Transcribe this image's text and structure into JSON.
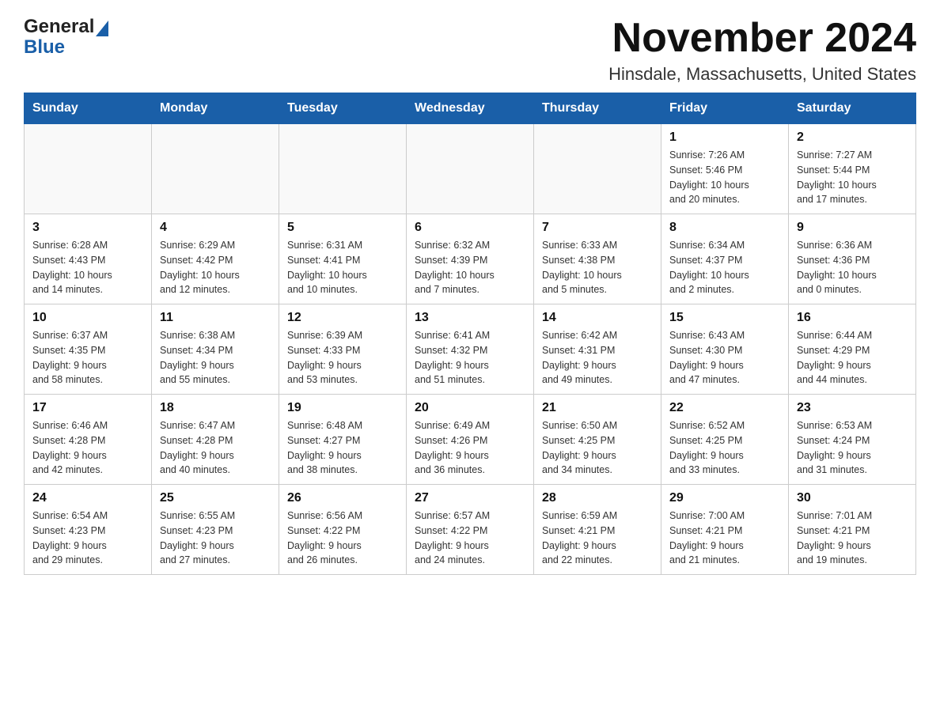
{
  "header": {
    "logo_general": "General",
    "logo_blue": "Blue",
    "title": "November 2024",
    "subtitle": "Hinsdale, Massachusetts, United States"
  },
  "days_of_week": [
    "Sunday",
    "Monday",
    "Tuesday",
    "Wednesday",
    "Thursday",
    "Friday",
    "Saturday"
  ],
  "weeks": [
    [
      {
        "day": "",
        "info": ""
      },
      {
        "day": "",
        "info": ""
      },
      {
        "day": "",
        "info": ""
      },
      {
        "day": "",
        "info": ""
      },
      {
        "day": "",
        "info": ""
      },
      {
        "day": "1",
        "info": "Sunrise: 7:26 AM\nSunset: 5:46 PM\nDaylight: 10 hours\nand 20 minutes."
      },
      {
        "day": "2",
        "info": "Sunrise: 7:27 AM\nSunset: 5:44 PM\nDaylight: 10 hours\nand 17 minutes."
      }
    ],
    [
      {
        "day": "3",
        "info": "Sunrise: 6:28 AM\nSunset: 4:43 PM\nDaylight: 10 hours\nand 14 minutes."
      },
      {
        "day": "4",
        "info": "Sunrise: 6:29 AM\nSunset: 4:42 PM\nDaylight: 10 hours\nand 12 minutes."
      },
      {
        "day": "5",
        "info": "Sunrise: 6:31 AM\nSunset: 4:41 PM\nDaylight: 10 hours\nand 10 minutes."
      },
      {
        "day": "6",
        "info": "Sunrise: 6:32 AM\nSunset: 4:39 PM\nDaylight: 10 hours\nand 7 minutes."
      },
      {
        "day": "7",
        "info": "Sunrise: 6:33 AM\nSunset: 4:38 PM\nDaylight: 10 hours\nand 5 minutes."
      },
      {
        "day": "8",
        "info": "Sunrise: 6:34 AM\nSunset: 4:37 PM\nDaylight: 10 hours\nand 2 minutes."
      },
      {
        "day": "9",
        "info": "Sunrise: 6:36 AM\nSunset: 4:36 PM\nDaylight: 10 hours\nand 0 minutes."
      }
    ],
    [
      {
        "day": "10",
        "info": "Sunrise: 6:37 AM\nSunset: 4:35 PM\nDaylight: 9 hours\nand 58 minutes."
      },
      {
        "day": "11",
        "info": "Sunrise: 6:38 AM\nSunset: 4:34 PM\nDaylight: 9 hours\nand 55 minutes."
      },
      {
        "day": "12",
        "info": "Sunrise: 6:39 AM\nSunset: 4:33 PM\nDaylight: 9 hours\nand 53 minutes."
      },
      {
        "day": "13",
        "info": "Sunrise: 6:41 AM\nSunset: 4:32 PM\nDaylight: 9 hours\nand 51 minutes."
      },
      {
        "day": "14",
        "info": "Sunrise: 6:42 AM\nSunset: 4:31 PM\nDaylight: 9 hours\nand 49 minutes."
      },
      {
        "day": "15",
        "info": "Sunrise: 6:43 AM\nSunset: 4:30 PM\nDaylight: 9 hours\nand 47 minutes."
      },
      {
        "day": "16",
        "info": "Sunrise: 6:44 AM\nSunset: 4:29 PM\nDaylight: 9 hours\nand 44 minutes."
      }
    ],
    [
      {
        "day": "17",
        "info": "Sunrise: 6:46 AM\nSunset: 4:28 PM\nDaylight: 9 hours\nand 42 minutes."
      },
      {
        "day": "18",
        "info": "Sunrise: 6:47 AM\nSunset: 4:28 PM\nDaylight: 9 hours\nand 40 minutes."
      },
      {
        "day": "19",
        "info": "Sunrise: 6:48 AM\nSunset: 4:27 PM\nDaylight: 9 hours\nand 38 minutes."
      },
      {
        "day": "20",
        "info": "Sunrise: 6:49 AM\nSunset: 4:26 PM\nDaylight: 9 hours\nand 36 minutes."
      },
      {
        "day": "21",
        "info": "Sunrise: 6:50 AM\nSunset: 4:25 PM\nDaylight: 9 hours\nand 34 minutes."
      },
      {
        "day": "22",
        "info": "Sunrise: 6:52 AM\nSunset: 4:25 PM\nDaylight: 9 hours\nand 33 minutes."
      },
      {
        "day": "23",
        "info": "Sunrise: 6:53 AM\nSunset: 4:24 PM\nDaylight: 9 hours\nand 31 minutes."
      }
    ],
    [
      {
        "day": "24",
        "info": "Sunrise: 6:54 AM\nSunset: 4:23 PM\nDaylight: 9 hours\nand 29 minutes."
      },
      {
        "day": "25",
        "info": "Sunrise: 6:55 AM\nSunset: 4:23 PM\nDaylight: 9 hours\nand 27 minutes."
      },
      {
        "day": "26",
        "info": "Sunrise: 6:56 AM\nSunset: 4:22 PM\nDaylight: 9 hours\nand 26 minutes."
      },
      {
        "day": "27",
        "info": "Sunrise: 6:57 AM\nSunset: 4:22 PM\nDaylight: 9 hours\nand 24 minutes."
      },
      {
        "day": "28",
        "info": "Sunrise: 6:59 AM\nSunset: 4:21 PM\nDaylight: 9 hours\nand 22 minutes."
      },
      {
        "day": "29",
        "info": "Sunrise: 7:00 AM\nSunset: 4:21 PM\nDaylight: 9 hours\nand 21 minutes."
      },
      {
        "day": "30",
        "info": "Sunrise: 7:01 AM\nSunset: 4:21 PM\nDaylight: 9 hours\nand 19 minutes."
      }
    ]
  ]
}
